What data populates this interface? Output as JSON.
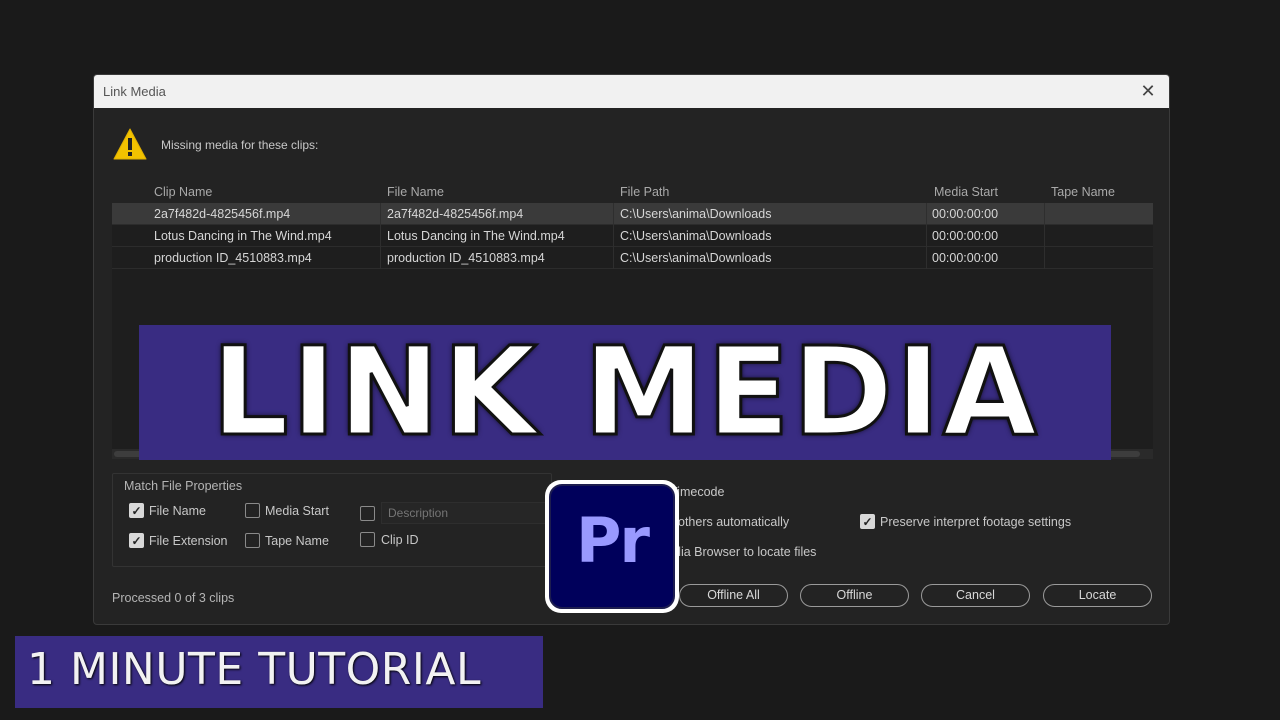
{
  "dialog": {
    "title": "Link Media",
    "close_glyph": "✕",
    "warning_icon": "warning-triangle-icon",
    "missing_label": "Missing media for these clips:"
  },
  "table": {
    "headers": [
      "Clip Name",
      "File Name",
      "File Path",
      "Media Start",
      "Tape Name"
    ],
    "rows": [
      [
        "2a7f482d-4825456f.mp4",
        "2a7f482d-4825456f.mp4",
        "C:\\Users\\anima\\Downloads",
        "00:00:00:00",
        ""
      ],
      [
        "Lotus Dancing in The Wind.mp4",
        "Lotus Dancing in The Wind.mp4",
        "C:\\Users\\anima\\Downloads",
        "00:00:00:00",
        ""
      ],
      [
        "production ID_4510883.mp4",
        "production ID_4510883.mp4",
        "C:\\Users\\anima\\Downloads",
        "00:00:00:00",
        ""
      ]
    ]
  },
  "match": {
    "group_label": "Match File Properties",
    "file_name": "File Name",
    "file_extension": "File Extension",
    "media_start": "Media Start",
    "tape_name": "Tape Name",
    "description_placeholder": "Description",
    "clip_id": "Clip ID",
    "checked_glyph": "✓"
  },
  "options": {
    "timecode": "Timecode",
    "others_automatically": "others automatically",
    "preserve": "Preserve interpret footage settings",
    "media_browser": "dia Browser to locate files"
  },
  "footer": {
    "processed": "Processed 0 of 3 clips",
    "buttons": [
      "Offline All",
      "Offline",
      "Cancel",
      "Locate"
    ]
  },
  "overlay": {
    "banner": "LINK MEDIA",
    "logo": "Pr",
    "tutorial": "1 MINUTE TUTORIAL"
  },
  "colors": {
    "dialog_bg": "#232323",
    "banner_bg": "#392c82",
    "premiere_bg": "#00005b",
    "premiere_text": "#9999ff",
    "warning": "#f2c200"
  }
}
